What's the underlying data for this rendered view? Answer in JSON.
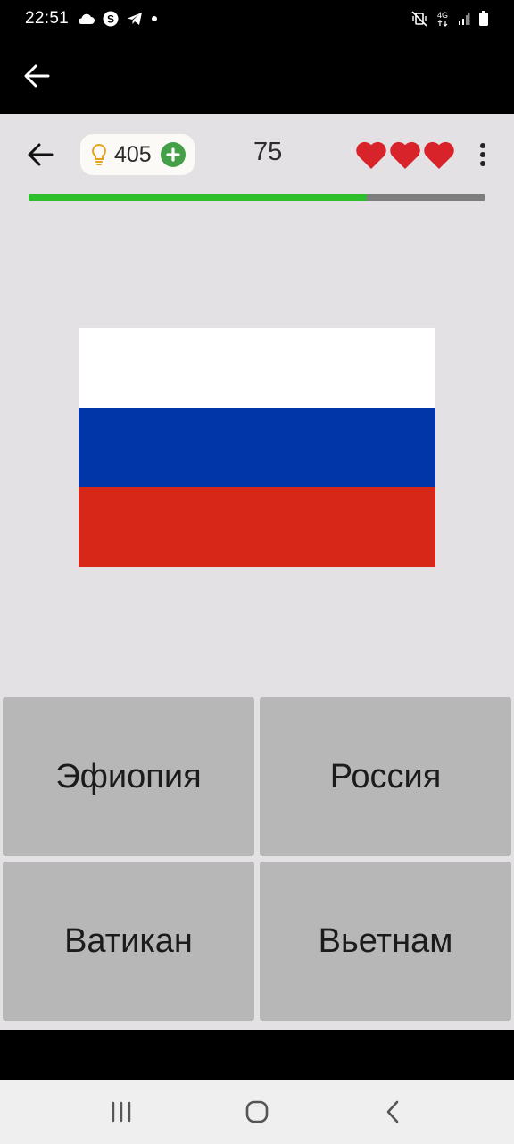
{
  "status_bar": {
    "time": "22:51",
    "left_icons": [
      "cloud-icon",
      "skype-icon",
      "telegram-icon",
      "dot-icon"
    ],
    "right_icons": [
      "mute-vibrate-icon",
      "4g-icon",
      "signal-icon",
      "battery-icon"
    ],
    "network_label": "4G"
  },
  "app_bar": {
    "back_icon": "arrow-left-icon"
  },
  "game_header": {
    "hints_count": "405",
    "score": "75",
    "lives": 3,
    "progress_fraction": 0.74
  },
  "flag": {
    "stripes": [
      "#ffffff",
      "#0036a8",
      "#d62718"
    ]
  },
  "answers": {
    "option_1": "Эфиопия",
    "option_2": "Россия",
    "option_3": "Ватикан",
    "option_4": "Вьетнам"
  },
  "colors": {
    "heart": "#d8232a",
    "progress": "#2dbd2d",
    "hint_plus": "#43a047",
    "answer_bg": "#b7b7b7"
  }
}
